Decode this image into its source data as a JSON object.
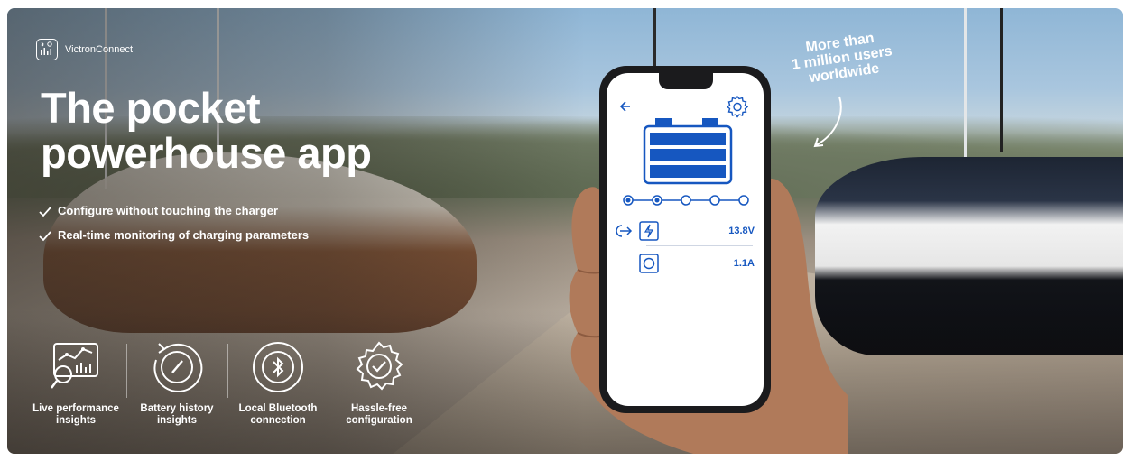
{
  "brand": {
    "name": "VictronConnect"
  },
  "headline": {
    "line1": "The pocket",
    "line2": "powerhouse app"
  },
  "features": [
    {
      "label": "Configure without touching the charger"
    },
    {
      "label": "Real-time monitoring of charging parameters"
    }
  ],
  "bottom_features": [
    {
      "label_line1": "Live performance",
      "label_line2": "insights",
      "icon": "performance-icon"
    },
    {
      "label_line1": "Battery history",
      "label_line2": "insights",
      "icon": "history-gauge-icon"
    },
    {
      "label_line1": "Local Bluetooth",
      "label_line2": "connection",
      "icon": "bluetooth-icon"
    },
    {
      "label_line1": "Hassle-free",
      "label_line2": "configuration",
      "icon": "gear-check-icon"
    }
  ],
  "callout": {
    "line1": "More than",
    "line2": "1 million users",
    "line3": "worldwide"
  },
  "phone": {
    "voltage": "13.8V",
    "current": "1.1A",
    "steps_total": 5,
    "steps_done": 2
  },
  "colors": {
    "accent": "#1657c0",
    "text_on_image": "#ffffff"
  }
}
